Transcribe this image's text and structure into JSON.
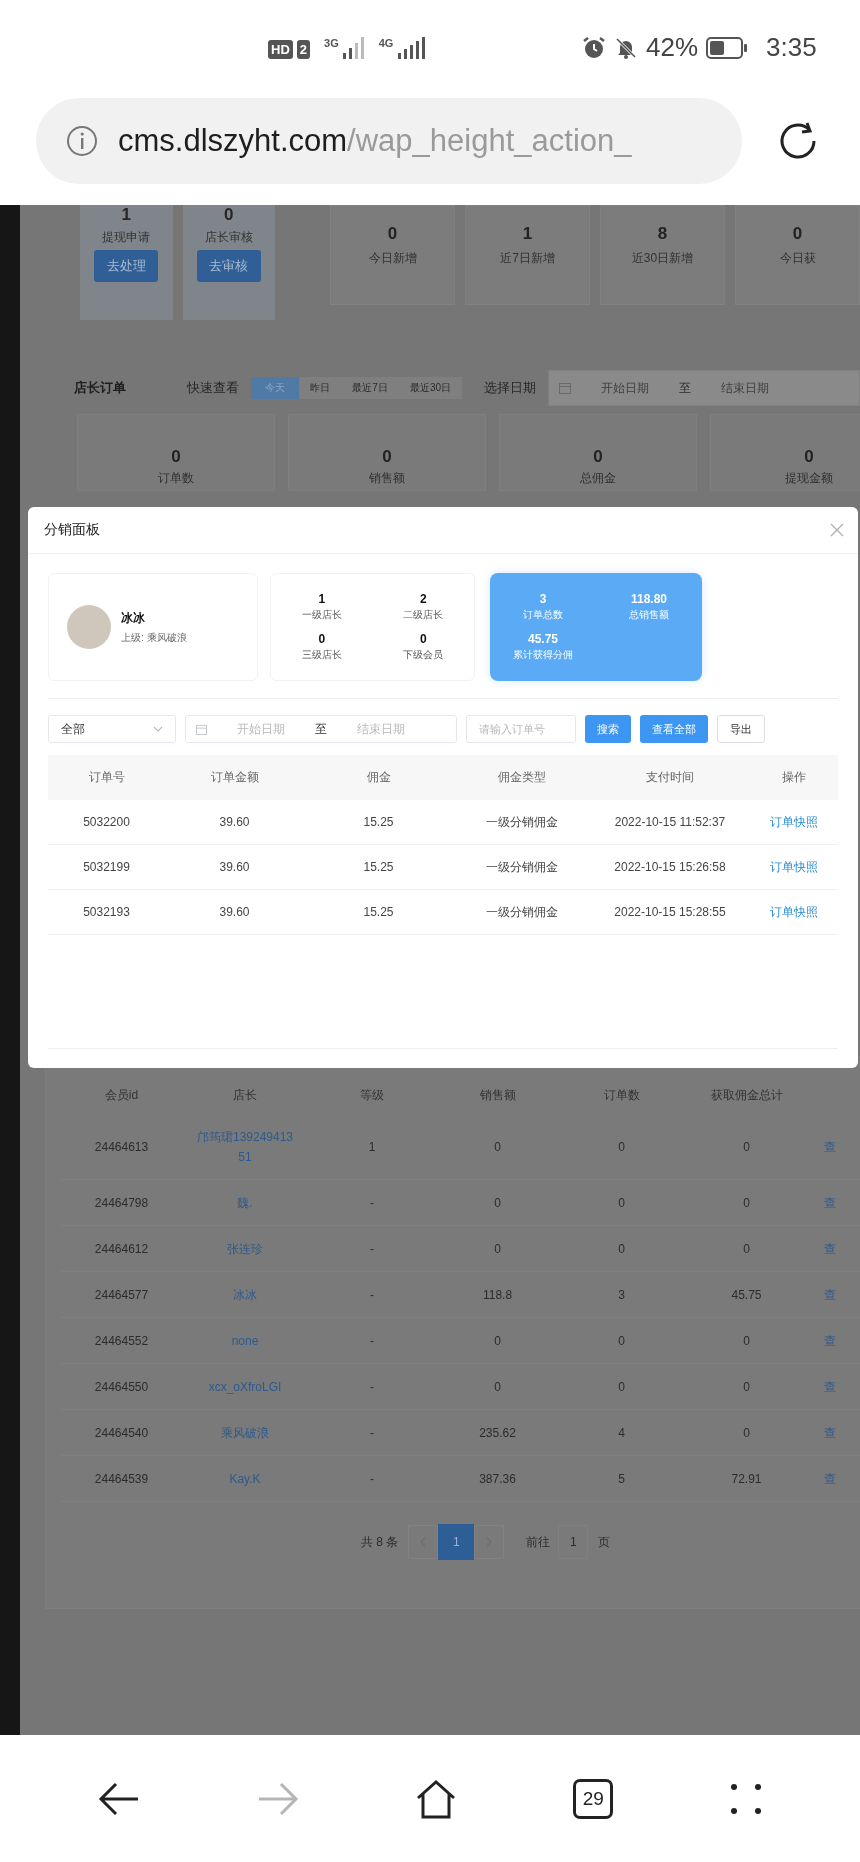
{
  "status_bar": {
    "hd": "HD",
    "sim": "2",
    "net1": "3G",
    "net2": "4G",
    "battery": "42%",
    "time": "3:35"
  },
  "browser": {
    "url_host": "cms.dlszyht.com",
    "url_path": "/wap_height_action_",
    "forward_disabled": true,
    "tab_count": "29"
  },
  "page": {
    "task_cards": [
      {
        "value": "1",
        "label": "提现申请",
        "button": "去处理"
      },
      {
        "value": "0",
        "label": "店长审核",
        "button": "去审核"
      }
    ],
    "stat_cards": [
      {
        "value": "0",
        "label": "今日新增"
      },
      {
        "value": "1",
        "label": "近7日新增"
      },
      {
        "value": "8",
        "label": "近30日新增"
      },
      {
        "value": "0",
        "label": "今日获"
      }
    ],
    "orders_filter": {
      "title": "店长订单",
      "quick_label": "快速查看",
      "quick_options": [
        {
          "label": "今天",
          "selected": true
        },
        {
          "label": "昨日",
          "selected": false
        },
        {
          "label": "最近7日",
          "selected": false
        },
        {
          "label": "最近30日",
          "selected": false
        }
      ],
      "date_label": "选择日期",
      "start_placeholder": "开始日期",
      "separator": "至",
      "end_placeholder": "结束日期"
    },
    "order_stats": [
      {
        "value": "0",
        "label": "订单数"
      },
      {
        "value": "0",
        "label": "销售额"
      },
      {
        "value": "0",
        "label": "总佣金"
      },
      {
        "value": "0",
        "label": "提现金额"
      }
    ],
    "members_table": {
      "columns": [
        "会员id",
        "店长",
        "等级",
        "销售额",
        "订单数",
        "获取佣金总计"
      ],
      "rows": [
        {
          "id": "24464613",
          "name": "邝筠珺13924941351",
          "level": "1",
          "sales": "0",
          "orders": "0",
          "commission": "0",
          "action": "查"
        },
        {
          "id": "24464798",
          "name": "魏.",
          "level": "-",
          "sales": "0",
          "orders": "0",
          "commission": "0",
          "action": "查"
        },
        {
          "id": "24464612",
          "name": "张连珍",
          "level": "-",
          "sales": "0",
          "orders": "0",
          "commission": "0",
          "action": "查"
        },
        {
          "id": "24464577",
          "name": "冰冰",
          "level": "-",
          "sales": "118.8",
          "orders": "3",
          "commission": "45.75",
          "action": "查"
        },
        {
          "id": "24464552",
          "name": "none",
          "level": "-",
          "sales": "0",
          "orders": "0",
          "commission": "0",
          "action": "查"
        },
        {
          "id": "24464550",
          "name": "xcx_oXfroLGI",
          "level": "-",
          "sales": "0",
          "orders": "0",
          "commission": "0",
          "action": "查"
        },
        {
          "id": "24464540",
          "name": "乘风破浪",
          "level": "-",
          "sales": "235.62",
          "orders": "4",
          "commission": "0",
          "action": "查"
        },
        {
          "id": "24464539",
          "name": "Kay.K",
          "level": "-",
          "sales": "387.36",
          "orders": "5",
          "commission": "72.91",
          "action": "查"
        }
      ]
    },
    "pagination": {
      "total": "共 8 条",
      "pages": [
        {
          "label": "1",
          "selected": true
        }
      ],
      "goto_label": "前往",
      "goto_value": "1",
      "page_suffix": "页"
    }
  },
  "modal": {
    "title": "分销面板",
    "profile": {
      "name": "冰冰",
      "parent": "上级: 乘风破浪"
    },
    "level_counts": [
      {
        "value": "1",
        "label": "一级店长"
      },
      {
        "value": "2",
        "label": "二级店长"
      },
      {
        "value": "0",
        "label": "三级店长"
      },
      {
        "value": "0",
        "label": "下级会员"
      }
    ],
    "summary": [
      {
        "value": "3",
        "label": "订单总数"
      },
      {
        "value": "118.80",
        "label": "总销售额"
      },
      {
        "value": "45.75",
        "label": "累计获得分佣"
      }
    ],
    "filters": {
      "select_value": "全部",
      "start_placeholder": "开始日期",
      "separator": "至",
      "end_placeholder": "结束日期",
      "order_placeholder": "请输入订单号",
      "buttons": [
        {
          "label": "搜索",
          "kind": "primary"
        },
        {
          "label": "查看全部",
          "kind": "primary"
        },
        {
          "label": "导出",
          "kind": "plain"
        }
      ]
    },
    "table": {
      "columns": [
        "订单号",
        "订单金额",
        "佣金",
        "佣金类型",
        "支付时间",
        "操作"
      ],
      "rows": [
        {
          "order_no": "5032200",
          "amount": "39.60",
          "commission": "15.25",
          "type": "一级分销佣金",
          "paid_at": "2022-10-15 11:52:37",
          "action": "订单快照"
        },
        {
          "order_no": "5032199",
          "amount": "39.60",
          "commission": "15.25",
          "type": "一级分销佣金",
          "paid_at": "2022-10-15 15:26:58",
          "action": "订单快照"
        },
        {
          "order_no": "5032193",
          "amount": "39.60",
          "commission": "15.25",
          "type": "一级分销佣金",
          "paid_at": "2022-10-15 15:28:55",
          "action": "订单快照"
        }
      ]
    }
  }
}
